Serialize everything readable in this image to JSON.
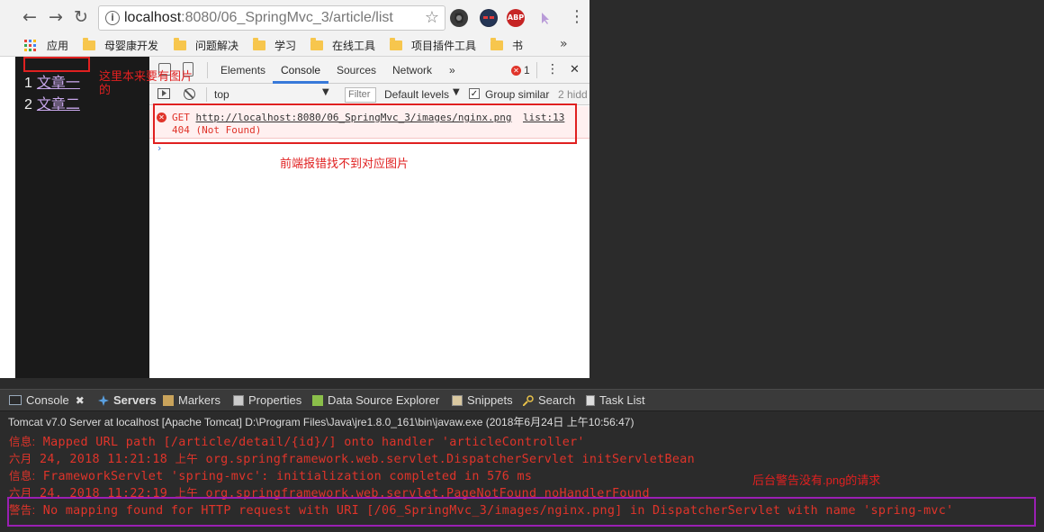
{
  "browser": {
    "back_symbol": "←",
    "forward_symbol": "→",
    "reload_symbol": "↻",
    "url_host": "localhost",
    "url_path": ":8080/06_SpringMvc_3/article/list",
    "extensions": [
      "evernote-icon",
      "spy-icon",
      "adblock-icon",
      "cursor-icon"
    ],
    "adblock_label": "ABP",
    "menu_symbol": "⋮"
  },
  "bookmarks": {
    "apps_label": "应用",
    "items": [
      "母婴康开发",
      "问题解决",
      "学习",
      "在线工具",
      "项目插件工具",
      "书"
    ],
    "more_symbol": "»"
  },
  "page": {
    "articles": [
      {
        "num": "1",
        "title": "文章一"
      },
      {
        "num": "2",
        "title": "文章二"
      }
    ],
    "image_note": "这里本来要有图片的"
  },
  "devtools": {
    "tabs": [
      "Elements",
      "Console",
      "Sources",
      "Network"
    ],
    "active_tab": "Console",
    "more_symbol": "»",
    "error_count": "1",
    "menu_symbol": "⋮",
    "close_symbol": "✕",
    "context": "top",
    "filter_placeholder": "Filter",
    "levels": "Default levels",
    "group_similar": "Group similar",
    "hidden": "2 hidd",
    "error": {
      "method": "GET",
      "url": "http://localhost:8080/06_SpringMvc_3/images/nginx.png",
      "source": "list:13",
      "status": "404 (Not Found)"
    },
    "prompt": "›",
    "front_note": "前端报错找不到对应图片"
  },
  "eclipse": {
    "tabs": [
      "Console",
      "Servers",
      "Markers",
      "Properties",
      "Data Source Explorer",
      "Snippets",
      "Search",
      "Task List"
    ],
    "close_symbol": "✖",
    "server_line": "Tomcat v7.0 Server at localhost [Apache Tomcat] D:\\Program Files\\Java\\jre1.8.0_161\\bin\\javaw.exe (2018年6月24日 上午10:56:47)",
    "log": [
      {
        "prefix": "信息:",
        "text": " Mapped URL path [/article/detail/{id}/] onto handler 'articleController'"
      },
      {
        "prefix": "六月",
        "text": " 24, 2018 11:21:18 ",
        "cn": "上午",
        "text2": " org.springframework.web.servlet.DispatcherServlet initServletBean"
      },
      {
        "prefix": "信息:",
        "text": " FrameworkServlet 'spring-mvc': initialization completed in 576 ms"
      },
      {
        "prefix": "六月",
        "text": " 24, 2018 11:22:19 ",
        "cn": "上午",
        "text2": " org.springframework.web.servlet.PageNotFound noHandlerFound"
      },
      {
        "prefix": "警告:",
        "text": " No mapping found for HTTP request with URI [/06_SpringMvc_3/images/nginx.png] in DispatcherServlet with name 'spring-mvc'"
      }
    ],
    "back_note": "后台警告没有.png的请求"
  },
  "colors": {
    "annotation_red": "#e02020",
    "warning_box_purple": "#9a1fb3",
    "link_purple": "#c7a6ea",
    "devtools_active_blue": "#3879d9"
  }
}
